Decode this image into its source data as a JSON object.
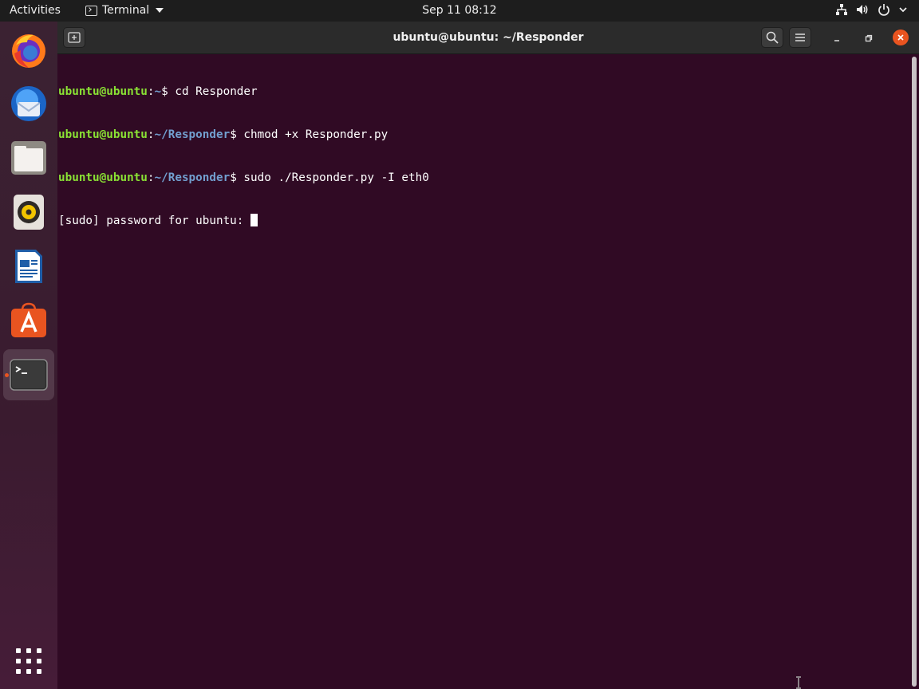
{
  "topbar": {
    "activities": "Activities",
    "app_menu": "Terminal",
    "clock": "Sep 11  08:12",
    "tray_icons": [
      "network-icon",
      "volume-icon",
      "power-icon",
      "chevron-down-icon"
    ]
  },
  "dock": {
    "items": [
      {
        "name": "firefox",
        "icon": "firefox-icon",
        "running": false
      },
      {
        "name": "thunderbird",
        "icon": "thunderbird-icon",
        "running": false
      },
      {
        "name": "files",
        "icon": "files-icon",
        "running": false
      },
      {
        "name": "rhythmbox",
        "icon": "rhythmbox-icon",
        "running": false
      },
      {
        "name": "libreoffice-writer",
        "icon": "writer-icon",
        "running": false
      },
      {
        "name": "ubuntu-software",
        "icon": "software-icon",
        "running": false
      },
      {
        "name": "terminal",
        "icon": "terminal-icon",
        "running": true
      }
    ],
    "show_apps_icon": "app-grid-icon"
  },
  "window": {
    "title": "ubuntu@ubuntu: ~/Responder",
    "terminal": {
      "lines": [
        {
          "user": "ubuntu@ubuntu",
          "sep": ":",
          "path": "~",
          "prompt": "$ ",
          "cmd": "cd Responder"
        },
        {
          "user": "ubuntu@ubuntu",
          "sep": ":",
          "path": "~/Responder",
          "prompt": "$ ",
          "cmd": "chmod +x Responder.py"
        },
        {
          "user": "ubuntu@ubuntu",
          "sep": ":",
          "path": "~/Responder",
          "prompt": "$ ",
          "cmd": "sudo ./Responder.py -I eth0"
        }
      ],
      "output": "[sudo] password for ubuntu: "
    }
  },
  "colors": {
    "terminal_bg": "#300a24",
    "user_green": "#8ae234",
    "path_blue": "#729fcf",
    "accent_orange": "#e95420"
  }
}
